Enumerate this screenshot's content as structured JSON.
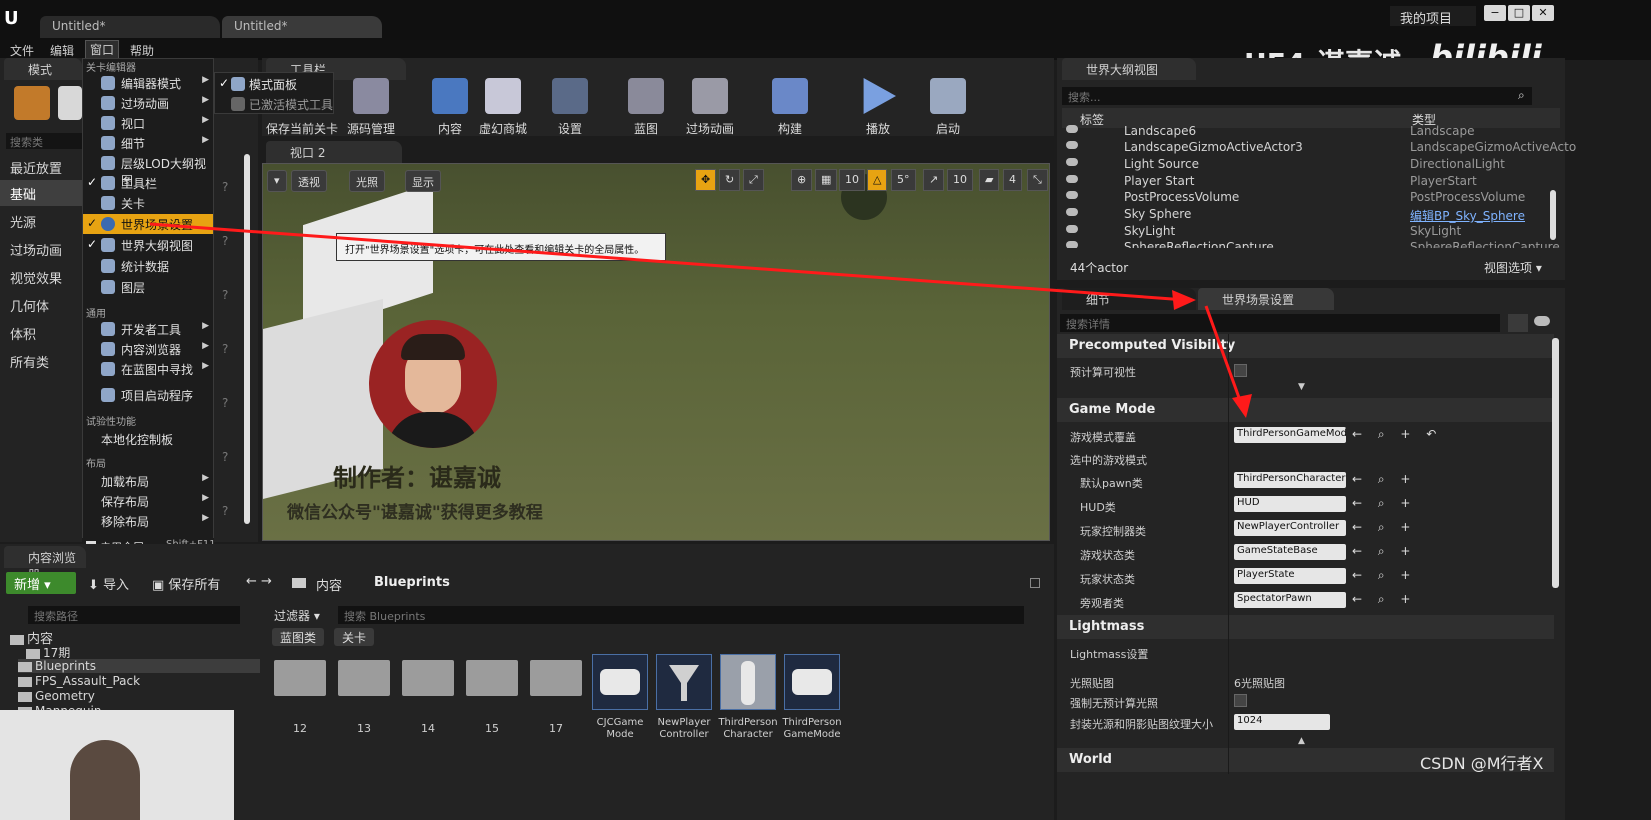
{
  "titlebar": {
    "tabs": [
      "Untitled*",
      "Untitled*"
    ],
    "project_name": "我的项目",
    "watermark": "UE4-谌嘉诚",
    "bilibili": "bilibili"
  },
  "menu": [
    "文件",
    "编辑",
    "窗口",
    "帮助"
  ],
  "modes_panel": {
    "tab": "模式",
    "search_placeholder": "搜索类",
    "items": [
      "最近放置",
      "基础",
      "光源",
      "过场动画",
      "视觉效果",
      "几何体",
      "体积",
      "所有类"
    ]
  },
  "window_menu": {
    "section_level_editor": "关卡编辑器",
    "items_level": [
      {
        "label": "编辑器模式",
        "check": false,
        "arrow": true
      },
      {
        "label": "过场动画",
        "check": false,
        "arrow": true
      },
      {
        "label": "视口",
        "check": false,
        "arrow": true
      },
      {
        "label": "细节",
        "check": false,
        "arrow": true
      },
      {
        "label": "层级LOD大纲视图",
        "check": false,
        "arrow": false
      },
      {
        "label": "工具栏",
        "check": true,
        "arrow": false
      },
      {
        "label": "关卡",
        "check": false,
        "arrow": false
      },
      {
        "label": "世界场景设置",
        "check": true,
        "arrow": false
      },
      {
        "label": "世界大纲视图",
        "check": true,
        "arrow": false
      },
      {
        "label": "统计数据",
        "check": false,
        "arrow": false
      },
      {
        "label": "图层",
        "check": false,
        "arrow": false
      }
    ],
    "section_general": "通用",
    "items_general": [
      {
        "label": "开发者工具",
        "arrow": true
      },
      {
        "label": "内容浏览器",
        "arrow": true
      },
      {
        "label": "在蓝图中寻找",
        "arrow": true
      },
      {
        "label": "项目启动程序",
        "arrow": false
      }
    ],
    "section_experimental": "试验性功能",
    "items_experimental": [
      "本地化控制板"
    ],
    "section_layout": "布局",
    "items_layout": [
      "加载布局",
      "保存布局",
      "移除布局"
    ],
    "fullscreen": "启用全屏",
    "fullscreen_shortcut": "Shift+F11",
    "submenu": [
      "模式面板",
      "已激活模式工具"
    ],
    "tooltip": "打开\"世界场景设置\"选项卡，可在此处查看和编辑关卡的全局属性。"
  },
  "toolbar": {
    "tab": "工具栏",
    "buttons": [
      "保存当前关卡",
      "源码管理",
      "内容",
      "虚幻商城",
      "设置",
      "蓝图",
      "过场动画",
      "构建",
      "播放",
      "启动"
    ]
  },
  "viewport": {
    "tab": "视口 2",
    "perspective": "透视",
    "lit": "光照",
    "show": "显示",
    "grid_snap": "10",
    "rot_snap": "5°",
    "scale_snap": "10",
    "cam_speed": "4",
    "overlay_author": "制作者：谌嘉诚",
    "overlay_wechat": "微信公众号\"谌嘉诚\"获得更多教程"
  },
  "outliner": {
    "tab": "世界大纲视图",
    "search_placeholder": "搜索...",
    "col_label": "标签",
    "col_type": "类型",
    "rows": [
      {
        "name": "Landscape6",
        "type": "Landscape"
      },
      {
        "name": "LandscapeGizmoActiveActor3",
        "type": "LandscapeGizmoActiveActo"
      },
      {
        "name": "Light Source",
        "type": "DirectionalLight"
      },
      {
        "name": "Player Start",
        "type": "PlayerStart"
      },
      {
        "name": "PostProcessVolume",
        "type": "PostProcessVolume"
      },
      {
        "name": "Sky Sphere",
        "type": "编辑BP_Sky_Sphere"
      },
      {
        "name": "SkyLight",
        "type": "SkyLight"
      },
      {
        "name": "SphereReflectionCapture",
        "type": "SphereReflectionCapture"
      }
    ],
    "actor_count": "44个actor",
    "view_options": "视图选项"
  },
  "details": {
    "tab_details": "细节",
    "tab_world": "世界场景设置",
    "search_placeholder": "搜索详情",
    "sec_precomputed": "Precomputed Visibility",
    "precomputed_label": "预计算可视性",
    "sec_gamemode": "Game Mode",
    "gamemode_override_label": "游戏模式覆盖",
    "gamemode_override_value": "ThirdPersonGameMode",
    "selected_gamemode": "选中的游戏模式",
    "props": [
      {
        "label": "默认pawn类",
        "value": "ThirdPersonCharacter"
      },
      {
        "label": "HUD类",
        "value": "HUD"
      },
      {
        "label": "玩家控制器类",
        "value": "NewPlayerController"
      },
      {
        "label": "游戏状态类",
        "value": "GameStateBase"
      },
      {
        "label": "玩家状态类",
        "value": "PlayerState"
      },
      {
        "label": "旁观者类",
        "value": "SpectatorPawn"
      }
    ],
    "sec_lightmass": "Lightmass",
    "lightmass_settings": "Lightmass设置",
    "lightmaps_label": "光照贴图",
    "lightmaps_value": "6光照贴图",
    "force_no_precomputed": "强制无预计算光照",
    "packed_size_label": "封装光源和阴影贴图纹理大小",
    "packed_size_value": "1024",
    "sec_world": "World"
  },
  "content_browser": {
    "tab": "内容浏览器",
    "add_new": "新增",
    "import": "导入",
    "save_all": "保存所有",
    "path": [
      "内容",
      "Blueprints"
    ],
    "search_paths_placeholder": "搜索路径",
    "filters": "过滤器",
    "search_placeholder": "搜索 Blueprints",
    "filter_pills": [
      "蓝图类",
      "关卡"
    ],
    "tree": [
      "内容",
      "17期",
      "Blueprints",
      "FPS_Assault_Pack",
      "Geometry",
      "Mannequin"
    ],
    "folders": [
      "12",
      "13",
      "14",
      "15",
      "17"
    ],
    "assets": [
      "CJCGame Mode",
      "NewPlayer Controller",
      "ThirdPerson Character",
      "ThirdPerson GameMode"
    ]
  },
  "watermark_csdn": "CSDN @M行者X",
  "colors": {
    "accent": "#e7a312",
    "arrow": "#ff1a1a",
    "link": "#7fb3ff"
  }
}
